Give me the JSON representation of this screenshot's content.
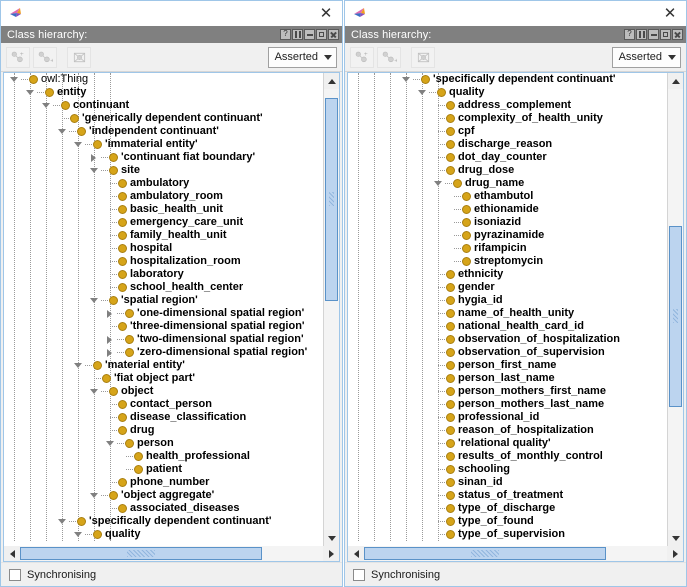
{
  "app": {
    "logo_icon": "protege-logo-icon",
    "close_icon": "close-icon"
  },
  "panels": [
    {
      "id": "left",
      "view_title": "Class hierarchy:",
      "view_buttons": [
        {
          "name": "help-button",
          "icon": "question-mark-icon",
          "glyph": "?"
        },
        {
          "name": "split-view-button",
          "icon": "split-pane-icon",
          "glyph": ""
        },
        {
          "name": "minimize-button",
          "icon": "minimize-icon",
          "glyph": ""
        },
        {
          "name": "maximize-button",
          "icon": "maximize-icon",
          "glyph": ""
        },
        {
          "name": "close-view-button",
          "icon": "close-icon",
          "glyph": ""
        }
      ],
      "toolbar": {
        "add_subclass_label": "Add subclass",
        "add_sibling_label": "Add sibling class",
        "delete_class_label": "Delete selected class",
        "reasoner_mode": "Asserted"
      },
      "status": {
        "checkbox_checked": false,
        "label": "Synchronising"
      },
      "vscroll": {
        "thumb_top_pct": 2,
        "thumb_height_pct": 46
      },
      "hscroll": {
        "thumb_left_pct": 0,
        "thumb_width_pct": 80
      },
      "tree": [
        {
          "label": "owl:Thing",
          "depth": 0,
          "twisty": "open",
          "bold": false
        },
        {
          "label": "entity",
          "depth": 1,
          "twisty": "open",
          "bold": true
        },
        {
          "label": "continuant",
          "depth": 2,
          "twisty": "open",
          "bold": true
        },
        {
          "label": "'generically dependent continuant'",
          "depth": 3,
          "twisty": "leaf",
          "bold": true
        },
        {
          "label": "'independent continuant'",
          "depth": 3,
          "twisty": "open",
          "bold": true
        },
        {
          "label": "'immaterial entity'",
          "depth": 4,
          "twisty": "open",
          "bold": true
        },
        {
          "label": "'continuant fiat boundary'",
          "depth": 5,
          "twisty": "closed",
          "bold": true
        },
        {
          "label": "site",
          "depth": 5,
          "twisty": "open",
          "bold": true
        },
        {
          "label": "ambulatory",
          "depth": 6,
          "twisty": "leaf",
          "bold": true
        },
        {
          "label": "ambulatory_room",
          "depth": 6,
          "twisty": "leaf",
          "bold": true
        },
        {
          "label": "basic_health_unit",
          "depth": 6,
          "twisty": "leaf",
          "bold": true
        },
        {
          "label": "emergency_care_unit",
          "depth": 6,
          "twisty": "leaf",
          "bold": true
        },
        {
          "label": "family_health_unit",
          "depth": 6,
          "twisty": "leaf",
          "bold": true
        },
        {
          "label": "hospital",
          "depth": 6,
          "twisty": "leaf",
          "bold": true
        },
        {
          "label": "hospitalization_room",
          "depth": 6,
          "twisty": "leaf",
          "bold": true
        },
        {
          "label": "laboratory",
          "depth": 6,
          "twisty": "leaf",
          "bold": true
        },
        {
          "label": "school_health_center",
          "depth": 6,
          "twisty": "leaf",
          "bold": true
        },
        {
          "label": "'spatial region'",
          "depth": 5,
          "twisty": "open",
          "bold": true
        },
        {
          "label": "'one-dimensional spatial region'",
          "depth": 6,
          "twisty": "closed",
          "bold": true
        },
        {
          "label": "'three-dimensional spatial region'",
          "depth": 6,
          "twisty": "leaf",
          "bold": true
        },
        {
          "label": "'two-dimensional spatial region'",
          "depth": 6,
          "twisty": "closed",
          "bold": true
        },
        {
          "label": "'zero-dimensional spatial region'",
          "depth": 6,
          "twisty": "closed",
          "bold": true
        },
        {
          "label": "'material entity'",
          "depth": 4,
          "twisty": "open",
          "bold": true
        },
        {
          "label": "'fiat object part'",
          "depth": 5,
          "twisty": "leaf",
          "bold": true
        },
        {
          "label": "object",
          "depth": 5,
          "twisty": "open",
          "bold": true
        },
        {
          "label": "contact_person",
          "depth": 6,
          "twisty": "leaf",
          "bold": true
        },
        {
          "label": "disease_classification",
          "depth": 6,
          "twisty": "leaf",
          "bold": true
        },
        {
          "label": "drug",
          "depth": 6,
          "twisty": "leaf",
          "bold": true
        },
        {
          "label": "person",
          "depth": 6,
          "twisty": "open",
          "bold": true
        },
        {
          "label": "health_professional",
          "depth": 7,
          "twisty": "leaf",
          "bold": true
        },
        {
          "label": "patient",
          "depth": 7,
          "twisty": "leaf",
          "bold": true
        },
        {
          "label": "phone_number",
          "depth": 6,
          "twisty": "leaf",
          "bold": true
        },
        {
          "label": "'object aggregate'",
          "depth": 5,
          "twisty": "open",
          "bold": true
        },
        {
          "label": "associated_diseases",
          "depth": 6,
          "twisty": "leaf",
          "bold": true
        },
        {
          "label": "'specifically dependent continuant'",
          "depth": 3,
          "twisty": "open",
          "bold": true
        },
        {
          "label": "quality",
          "depth": 4,
          "twisty": "open",
          "bold": true
        }
      ]
    },
    {
      "id": "right",
      "view_title": "Class hierarchy:",
      "view_buttons": [
        {
          "name": "help-button",
          "icon": "question-mark-icon",
          "glyph": "?"
        },
        {
          "name": "split-view-button",
          "icon": "split-pane-icon",
          "glyph": ""
        },
        {
          "name": "minimize-button",
          "icon": "minimize-icon",
          "glyph": ""
        },
        {
          "name": "maximize-button",
          "icon": "maximize-icon",
          "glyph": ""
        },
        {
          "name": "close-view-button",
          "icon": "close-icon",
          "glyph": ""
        }
      ],
      "toolbar": {
        "add_subclass_label": "Add subclass",
        "add_sibling_label": "Add sibling class",
        "delete_class_label": "Delete selected class",
        "reasoner_mode": "Asserted"
      },
      "status": {
        "checkbox_checked": false,
        "label": "Synchronising"
      },
      "vscroll": {
        "thumb_top_pct": 31,
        "thumb_height_pct": 41
      },
      "hscroll": {
        "thumb_left_pct": 0,
        "thumb_width_pct": 80
      },
      "tree": [
        {
          "label": "'specifically dependent continuant'",
          "depth": 3,
          "twisty": "open",
          "bold": true
        },
        {
          "label": "quality",
          "depth": 4,
          "twisty": "open",
          "bold": true
        },
        {
          "label": "address_complement",
          "depth": 5,
          "twisty": "leaf",
          "bold": true
        },
        {
          "label": "complexity_of_health_unity",
          "depth": 5,
          "twisty": "leaf",
          "bold": true
        },
        {
          "label": "cpf",
          "depth": 5,
          "twisty": "leaf",
          "bold": true
        },
        {
          "label": "discharge_reason",
          "depth": 5,
          "twisty": "leaf",
          "bold": true
        },
        {
          "label": "dot_day_counter",
          "depth": 5,
          "twisty": "leaf",
          "bold": true
        },
        {
          "label": "drug_dose",
          "depth": 5,
          "twisty": "leaf",
          "bold": true
        },
        {
          "label": "drug_name",
          "depth": 5,
          "twisty": "open",
          "bold": true
        },
        {
          "label": "ethambutol",
          "depth": 6,
          "twisty": "leaf",
          "bold": true
        },
        {
          "label": "ethionamide",
          "depth": 6,
          "twisty": "leaf",
          "bold": true
        },
        {
          "label": "isoniazid",
          "depth": 6,
          "twisty": "leaf",
          "bold": true
        },
        {
          "label": "pyrazinamide",
          "depth": 6,
          "twisty": "leaf",
          "bold": true
        },
        {
          "label": "rifampicin",
          "depth": 6,
          "twisty": "leaf",
          "bold": true
        },
        {
          "label": "streptomycin",
          "depth": 6,
          "twisty": "leaf",
          "bold": true
        },
        {
          "label": "ethnicity",
          "depth": 5,
          "twisty": "leaf",
          "bold": true
        },
        {
          "label": "gender",
          "depth": 5,
          "twisty": "leaf",
          "bold": true
        },
        {
          "label": "hygia_id",
          "depth": 5,
          "twisty": "leaf",
          "bold": true
        },
        {
          "label": "name_of_health_unity",
          "depth": 5,
          "twisty": "leaf",
          "bold": true
        },
        {
          "label": "national_health_card_id",
          "depth": 5,
          "twisty": "leaf",
          "bold": true
        },
        {
          "label": "observation_of_hospitalization",
          "depth": 5,
          "twisty": "leaf",
          "bold": true
        },
        {
          "label": "observation_of_supervision",
          "depth": 5,
          "twisty": "leaf",
          "bold": true
        },
        {
          "label": "person_first_name",
          "depth": 5,
          "twisty": "leaf",
          "bold": true
        },
        {
          "label": "person_last_name",
          "depth": 5,
          "twisty": "leaf",
          "bold": true
        },
        {
          "label": "person_mothers_first_name",
          "depth": 5,
          "twisty": "leaf",
          "bold": true
        },
        {
          "label": "person_mothers_last_name",
          "depth": 5,
          "twisty": "leaf",
          "bold": true
        },
        {
          "label": "professional_id",
          "depth": 5,
          "twisty": "leaf",
          "bold": true
        },
        {
          "label": "reason_of_hospitalization",
          "depth": 5,
          "twisty": "leaf",
          "bold": true
        },
        {
          "label": "'relational quality'",
          "depth": 5,
          "twisty": "leaf",
          "bold": true
        },
        {
          "label": "results_of_monthly_control",
          "depth": 5,
          "twisty": "leaf",
          "bold": true
        },
        {
          "label": "schooling",
          "depth": 5,
          "twisty": "leaf",
          "bold": true
        },
        {
          "label": "sinan_id",
          "depth": 5,
          "twisty": "leaf",
          "bold": true
        },
        {
          "label": "status_of_treatment",
          "depth": 5,
          "twisty": "leaf",
          "bold": true
        },
        {
          "label": "type_of_discharge",
          "depth": 5,
          "twisty": "leaf",
          "bold": true
        },
        {
          "label": "type_of_found",
          "depth": 5,
          "twisty": "leaf",
          "bold": true
        },
        {
          "label": "type_of_supervision",
          "depth": 5,
          "twisty": "leaf",
          "bold": true
        }
      ]
    }
  ],
  "colors": {
    "node_fill": "#d6a419",
    "header_bar": "#808080",
    "frame_border": "#9fc6e8",
    "scroll_thumb": "#bcd4ef"
  }
}
